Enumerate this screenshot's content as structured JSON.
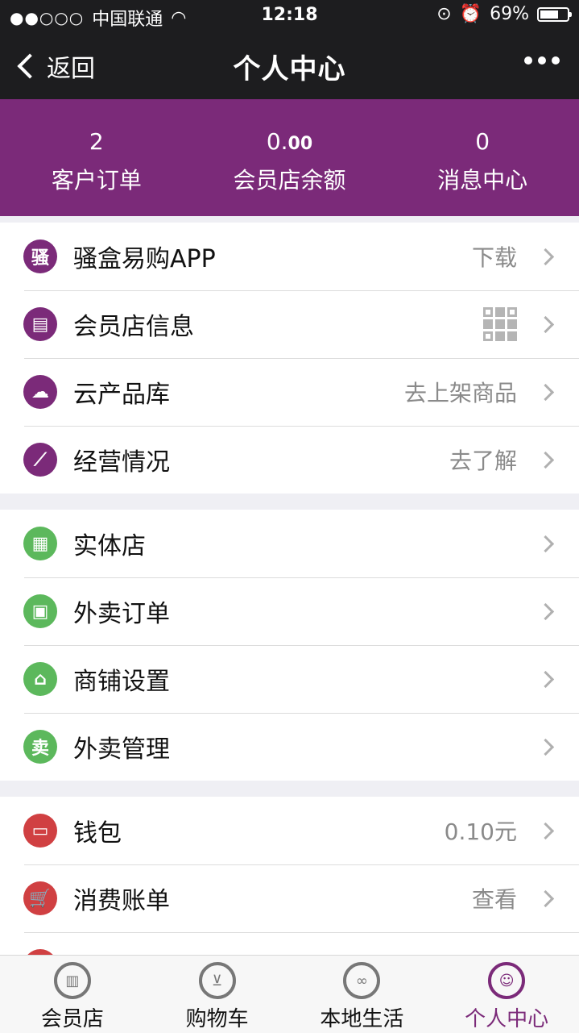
{
  "status_bar": {
    "carrier": "中国联通",
    "signal": "●●○○○",
    "time": "12:18",
    "battery": "69%",
    "battery_level": 0.69
  },
  "nav": {
    "back_label": "返回",
    "title": "个人中心"
  },
  "stats": [
    {
      "value": "2",
      "label": "客户订单"
    },
    {
      "value_main": "0.",
      "value_small": "00",
      "label": "会员店余额"
    },
    {
      "value": "0",
      "label": "消息中心"
    }
  ],
  "group1": [
    {
      "icon_char": "骚",
      "title": "骚盒易购APP",
      "value": "下载"
    },
    {
      "icon_char": "▤",
      "title": "会员店信息",
      "value": ""
    },
    {
      "icon_char": "☁",
      "title": "云产品库",
      "value": "去上架商品"
    },
    {
      "icon_char": "⟋",
      "title": "经营情况",
      "value": "去了解"
    }
  ],
  "group2": [
    {
      "icon_char": "▦",
      "title": "实体店"
    },
    {
      "icon_char": "▣",
      "title": "外卖订单"
    },
    {
      "icon_char": "⌂",
      "title": "商铺设置"
    },
    {
      "icon_char": "卖",
      "title": "外卖管理"
    }
  ],
  "group3": [
    {
      "icon_char": "▭",
      "title": "钱包",
      "value": "0.10元"
    },
    {
      "icon_char": "🛒",
      "title": "消费账单",
      "value": "查看"
    }
  ],
  "tabbar": [
    {
      "label": "会员店",
      "icon": "store-icon"
    },
    {
      "label": "购物车",
      "icon": "cart-icon"
    },
    {
      "label": "本地生活",
      "icon": "local-life-icon"
    },
    {
      "label": "个人中心",
      "icon": "user-icon",
      "active": true
    }
  ]
}
